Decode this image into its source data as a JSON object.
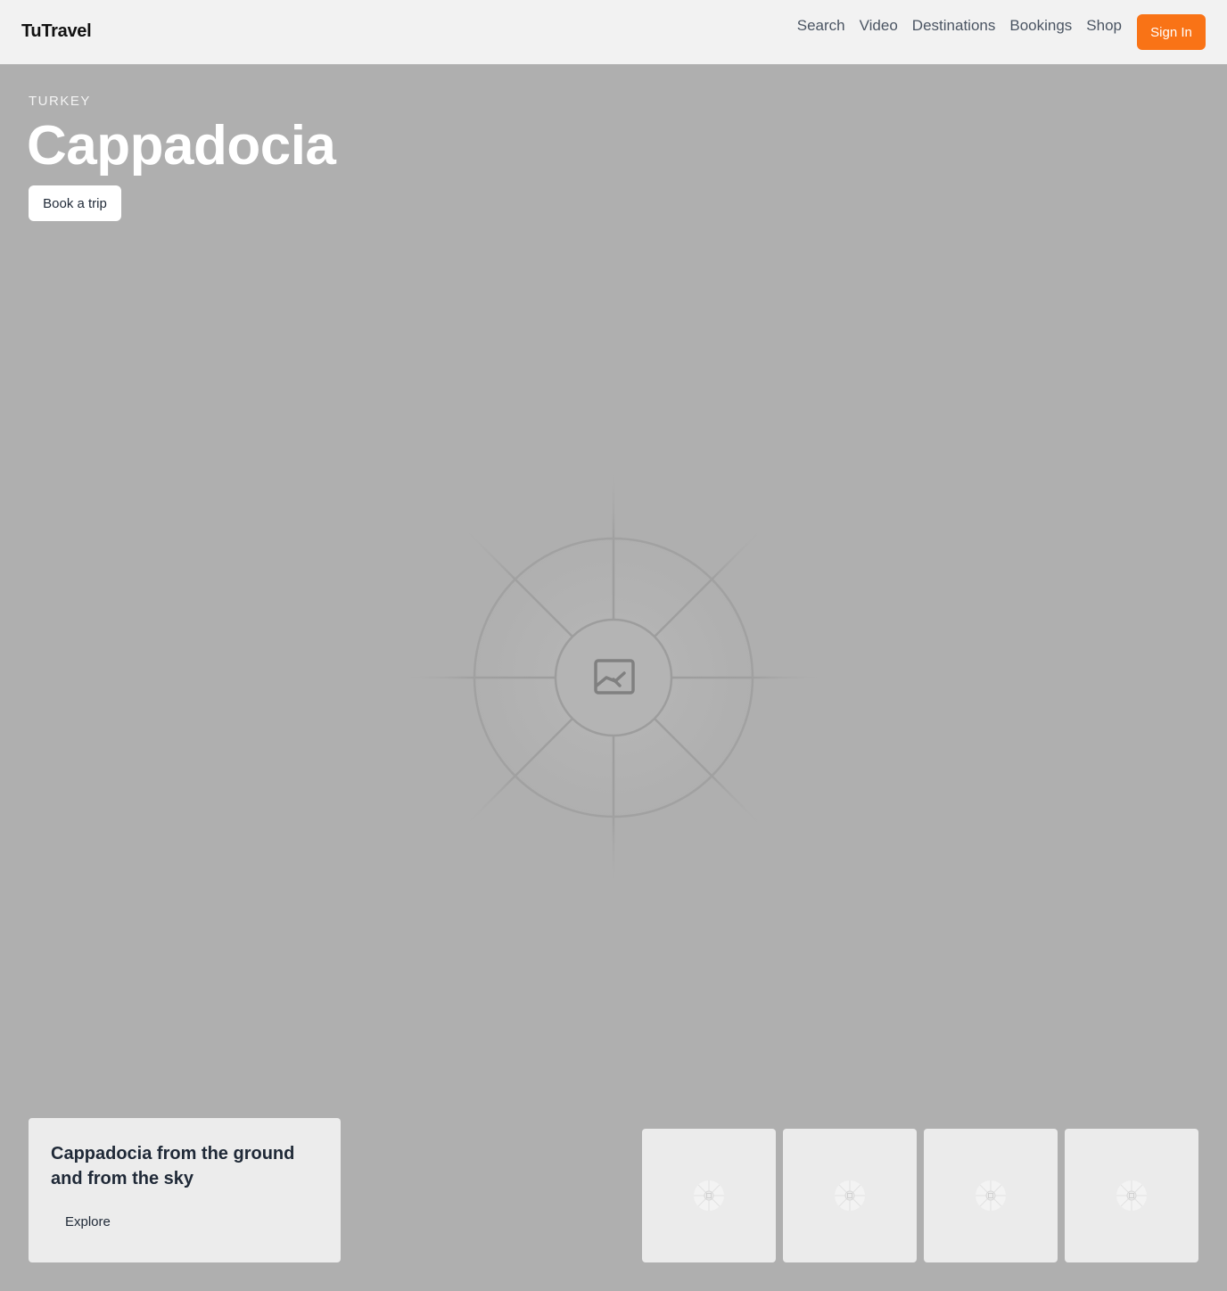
{
  "header": {
    "brand": "TuTravel",
    "nav": [
      "Search",
      "Video",
      "Destinations",
      "Bookings",
      "Shop"
    ],
    "signin_label": "Sign In",
    "accent_color": "#f97316"
  },
  "hero": {
    "eyebrow": "TURKEY",
    "title": "Cappadocia",
    "cta_label": "Book a trip",
    "image_icon": "image-placeholder-icon"
  },
  "feature": {
    "title": "Cappadocia from the ground and from the sky",
    "cta_label": "Explore"
  },
  "thumbnails": [
    {
      "icon": "image-placeholder-icon"
    },
    {
      "icon": "image-placeholder-icon"
    },
    {
      "icon": "image-placeholder-icon"
    },
    {
      "icon": "image-placeholder-icon"
    }
  ]
}
